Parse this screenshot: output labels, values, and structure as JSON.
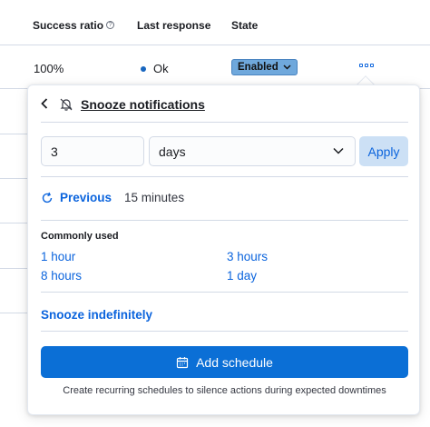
{
  "table": {
    "headers": {
      "success_ratio": "Success ratio",
      "last_response": "Last response",
      "state": "State"
    },
    "row": {
      "success_ratio": "100%",
      "last_response": "Ok",
      "state": "Enabled"
    }
  },
  "popover": {
    "title": "Snooze notifications",
    "duration_value": "3",
    "duration_unit": "days",
    "apply_label": "Apply",
    "previous_label": "Previous",
    "previous_value": "15 minutes",
    "commonly_used_label": "Commonly used",
    "options": [
      "1 hour",
      "3 hours",
      "8 hours",
      "1 day"
    ],
    "snooze_indefinitely_label": "Snooze indefinitely",
    "add_schedule_label": "Add schedule",
    "schedule_hint": "Create recurring schedules to silence actions during expected downtimes"
  },
  "colors": {
    "link": "#0b64dd",
    "primary_button": "#0b6fd6",
    "badge": "#6fa8dc",
    "status_dot": "#1866bf"
  }
}
